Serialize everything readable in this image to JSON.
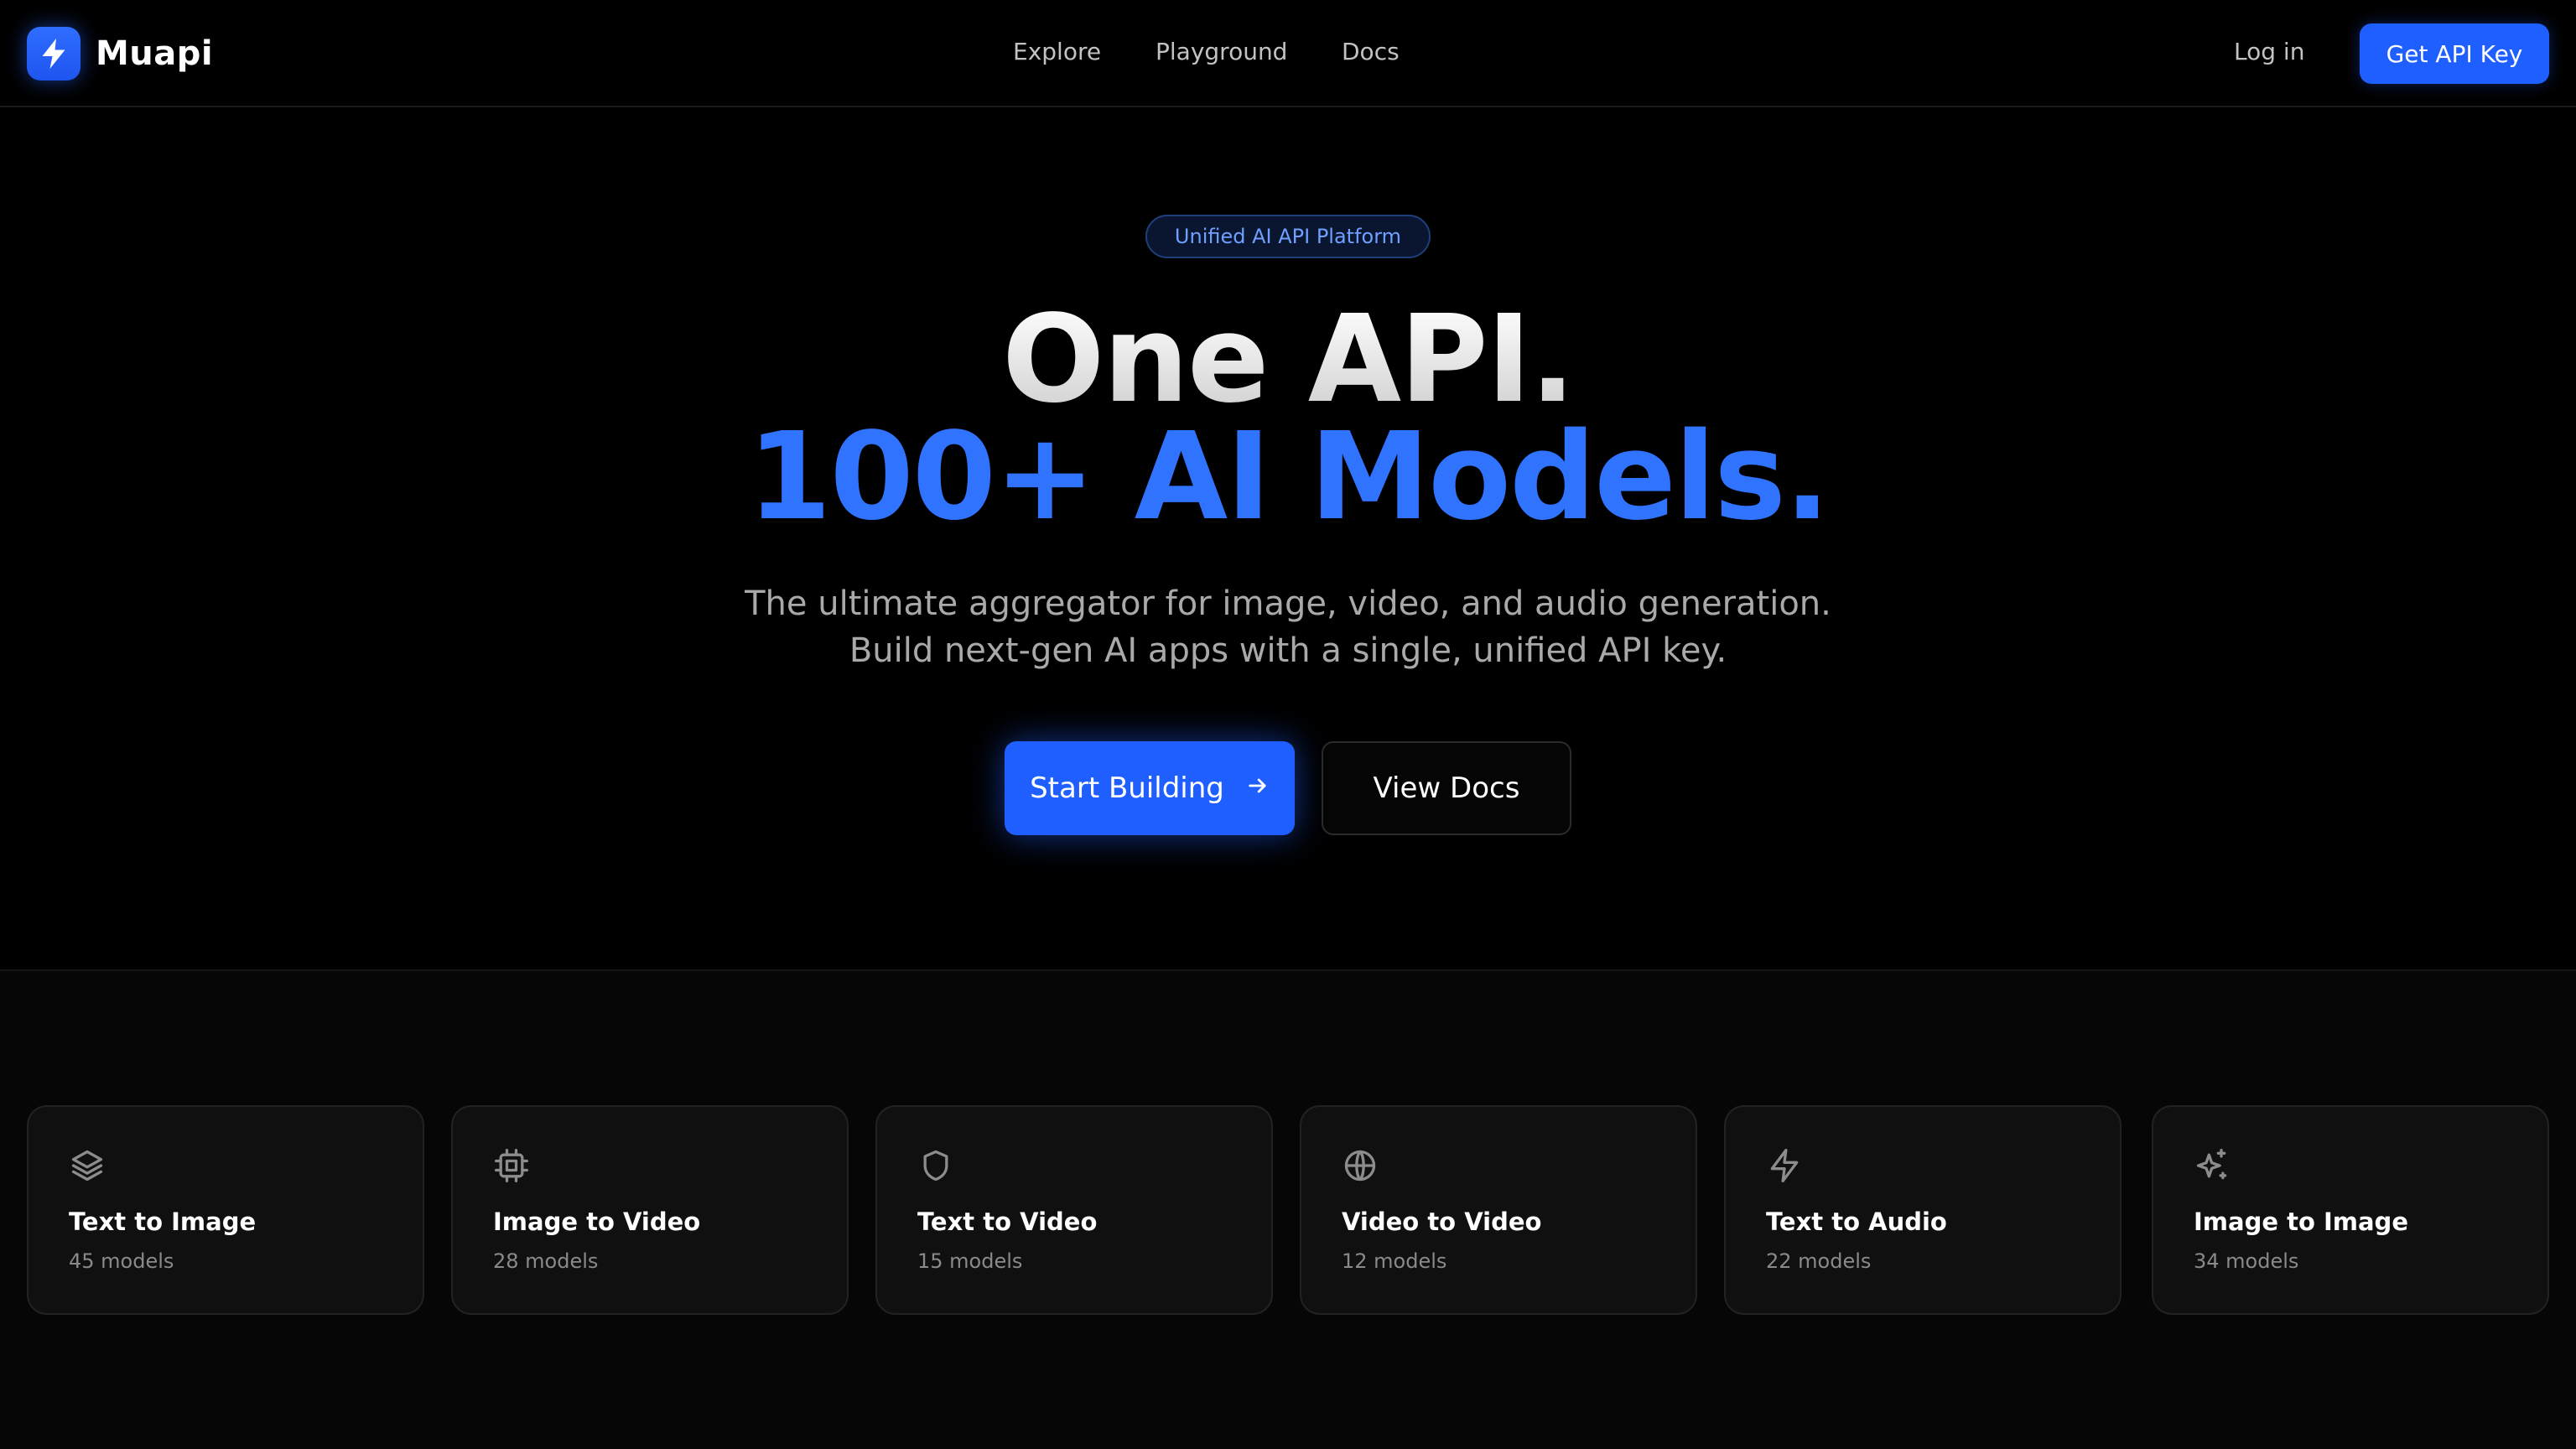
{
  "brand": {
    "name": "Muapi",
    "logo_icon": "lightning-icon"
  },
  "nav": {
    "links": [
      {
        "label": "Explore"
      },
      {
        "label": "Playground"
      },
      {
        "label": "Docs"
      }
    ],
    "login_label": "Log in",
    "api_key_label": "Get API Key"
  },
  "hero": {
    "badge": "Unified AI API Platform",
    "headline_line1": "One API.",
    "headline_line2": "100+ AI Models.",
    "subtitle_line1": "The ultimate aggregator for image, video, and audio generation.",
    "subtitle_line2": "Build next-gen AI apps with a single, unified API key.",
    "primary_cta": "Start Building",
    "secondary_cta": "View Docs"
  },
  "categories": [
    {
      "title": "Text to Image",
      "count": "45 models",
      "icon": "layers-icon"
    },
    {
      "title": "Image to Video",
      "count": "28 models",
      "icon": "cpu-chip-icon"
    },
    {
      "title": "Text to Video",
      "count": "15 models",
      "icon": "shield-icon"
    },
    {
      "title": "Video to Video",
      "count": "12 models",
      "icon": "globe-icon"
    },
    {
      "title": "Text to Audio",
      "count": "22 models",
      "icon": "lightning-icon"
    },
    {
      "title": "Image to Image",
      "count": "34 models",
      "icon": "sparkles-icon"
    }
  ],
  "colors": {
    "accent": "#1f5fff",
    "headline_blue": "#2f73ff",
    "background": "#000000",
    "card_bg": "#101010"
  }
}
